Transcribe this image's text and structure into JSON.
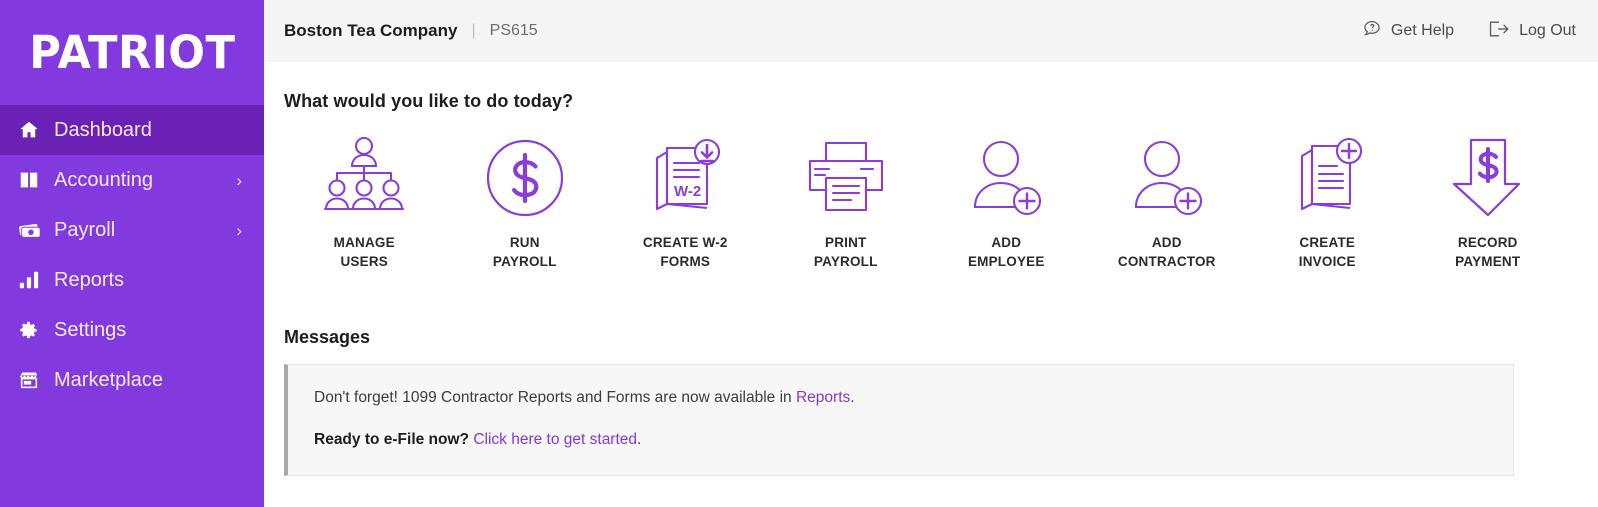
{
  "brand": {
    "logo_text": "PATRIOT",
    "sidebar_color": "#8239dd",
    "active_color": "#6b21b5",
    "icon_color": "#8a3ddb"
  },
  "sidebar": {
    "items": [
      {
        "label": "Dashboard",
        "icon": "home-icon",
        "active": true,
        "chevron": ""
      },
      {
        "label": "Accounting",
        "icon": "book-icon",
        "active": false,
        "chevron": "›"
      },
      {
        "label": "Payroll",
        "icon": "money-icon",
        "active": false,
        "chevron": "›"
      },
      {
        "label": "Reports",
        "icon": "bar-chart-icon",
        "active": false,
        "chevron": ""
      },
      {
        "label": "Settings",
        "icon": "gear-icon",
        "active": false,
        "chevron": ""
      },
      {
        "label": "Marketplace",
        "icon": "storefront-icon",
        "active": false,
        "chevron": ""
      }
    ]
  },
  "header": {
    "company_name": "Boston Tea Company",
    "separator": "|",
    "account_id": "PS615",
    "get_help_label": "Get Help",
    "log_out_label": "Log Out"
  },
  "main": {
    "heading": "What would you like to do today?",
    "actions": [
      {
        "line1": "MANAGE",
        "line2": "USERS",
        "icon": "org-chart-users-icon"
      },
      {
        "line1": "RUN",
        "line2": "PAYROLL",
        "icon": "dollar-circle-icon"
      },
      {
        "line1": "CREATE W-2",
        "line2": "FORMS",
        "icon": "w2-documents-download-icon"
      },
      {
        "line1": "PRINT",
        "line2": "PAYROLL",
        "icon": "printer-icon"
      },
      {
        "line1": "ADD",
        "line2": "EMPLOYEE",
        "icon": "person-plus-icon"
      },
      {
        "line1": "ADD",
        "line2": "CONTRACTOR",
        "icon": "person-plus-icon"
      },
      {
        "line1": "CREATE",
        "line2": "INVOICE",
        "icon": "documents-plus-icon"
      },
      {
        "line1": "RECORD",
        "line2": "PAYMENT",
        "icon": "arrow-down-dollar-icon"
      }
    ],
    "messages_title": "Messages",
    "messages": {
      "line1_pre": "Don't forget! 1099 Contractor Reports and Forms are now available in ",
      "line1_link": "Reports",
      "line1_post": ".",
      "line2_strong": "Ready to e-File now?",
      "line2_link": "Click here to get started",
      "line2_post": "."
    }
  }
}
